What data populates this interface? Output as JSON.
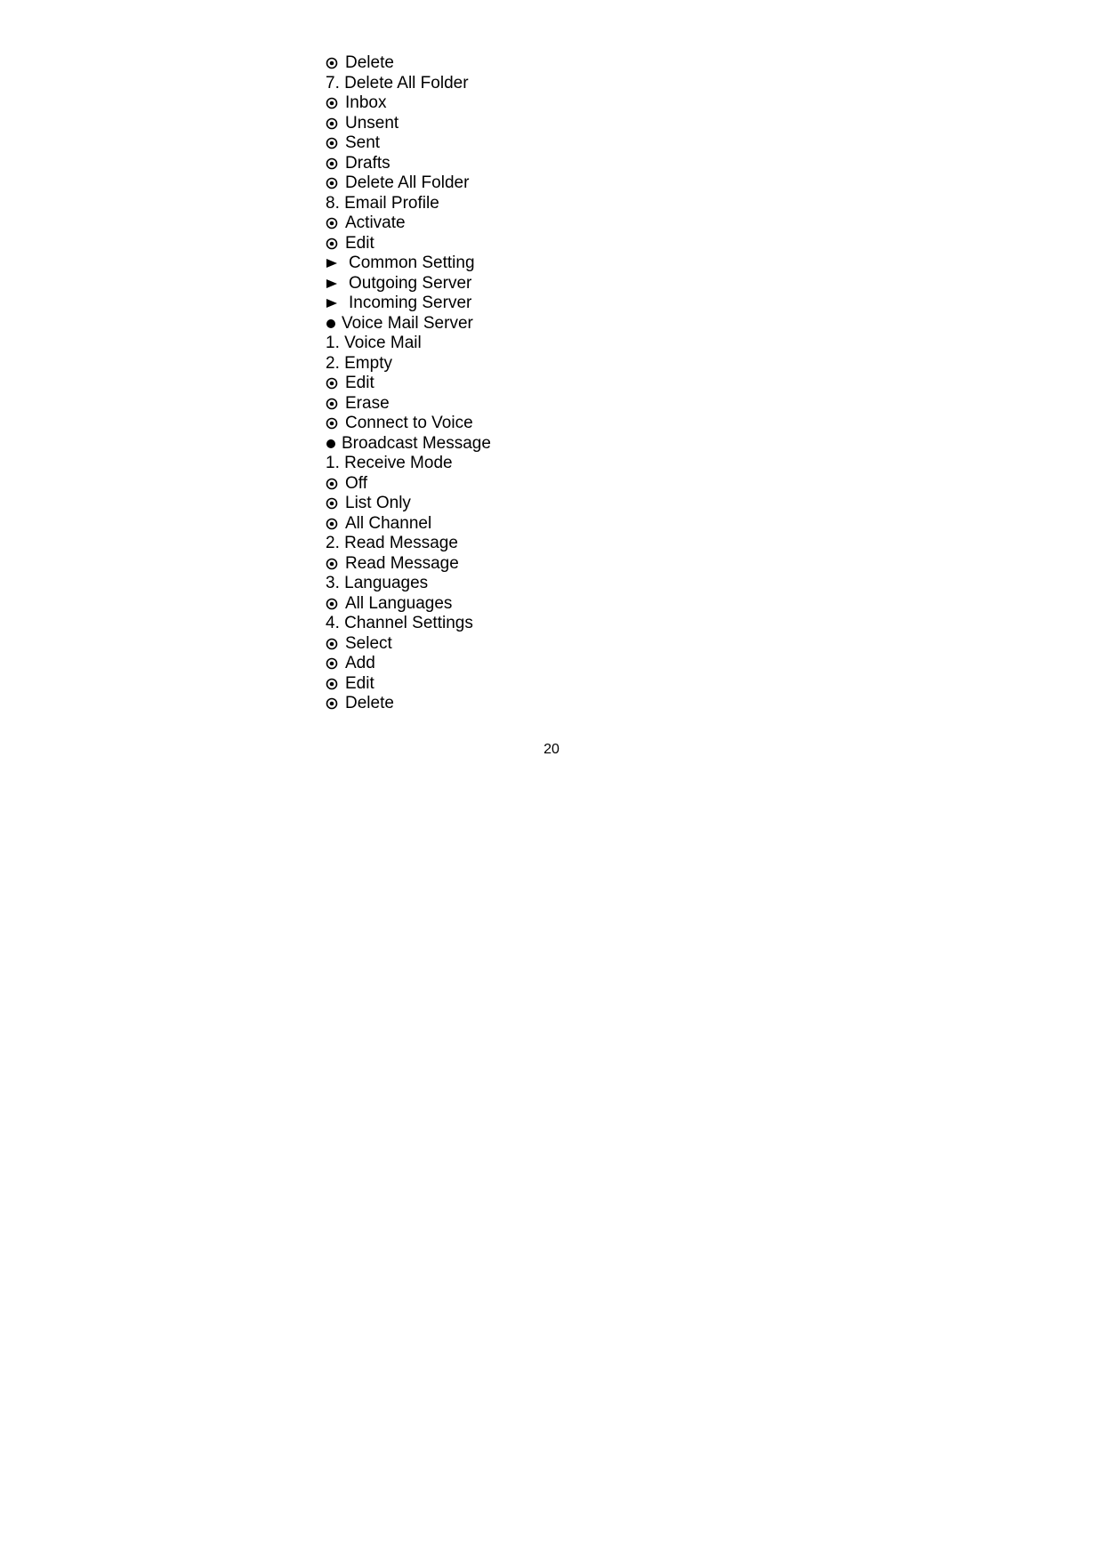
{
  "page_number": "20",
  "lines": [
    {
      "marker": "odot",
      "gap": 4,
      "text": "Delete"
    },
    {
      "marker": "none",
      "gap": 0,
      "text": "7. Delete All Folder"
    },
    {
      "marker": "odot",
      "gap": 4,
      "text": "Inbox"
    },
    {
      "marker": "odot",
      "gap": 4,
      "text": "Unsent"
    },
    {
      "marker": "odot",
      "gap": 4,
      "text": "Sent"
    },
    {
      "marker": "odot",
      "gap": 4,
      "text": "Drafts"
    },
    {
      "marker": "odot",
      "gap": 4,
      "text": "Delete All Folder"
    },
    {
      "marker": "none",
      "gap": 0,
      "text": "8. Email Profile"
    },
    {
      "marker": "odot",
      "gap": 4,
      "text": "Activate"
    },
    {
      "marker": "odot",
      "gap": 4,
      "text": "Edit"
    },
    {
      "marker": "tri",
      "gap": 8,
      "text": "Common Setting"
    },
    {
      "marker": "tri",
      "gap": 8,
      "text": "Outgoing Server"
    },
    {
      "marker": "tri",
      "gap": 8,
      "text": "Incoming Server"
    },
    {
      "marker": "disc",
      "gap": 0,
      "text": "Voice Mail Server"
    },
    {
      "marker": "none",
      "gap": 0,
      "text": "1. Voice Mail"
    },
    {
      "marker": "none",
      "gap": 0,
      "text": "2. Empty"
    },
    {
      "marker": "odot",
      "gap": 4,
      "text": "Edit"
    },
    {
      "marker": "odot",
      "gap": 4,
      "text": "Erase"
    },
    {
      "marker": "odot",
      "gap": 4,
      "text": "Connect to Voice"
    },
    {
      "marker": "disc",
      "gap": 0,
      "text": "Broadcast Message"
    },
    {
      "marker": "none",
      "gap": 0,
      "text": "1. Receive Mode"
    },
    {
      "marker": "odot",
      "gap": 4,
      "text": "Off"
    },
    {
      "marker": "odot",
      "gap": 4,
      "text": "List Only"
    },
    {
      "marker": "odot",
      "gap": 4,
      "text": "All Channel"
    },
    {
      "marker": "none",
      "gap": 0,
      "text": "2. Read Message"
    },
    {
      "marker": "odot",
      "gap": 4,
      "text": "Read Message"
    },
    {
      "marker": "none",
      "gap": 0,
      "text": "3. Languages"
    },
    {
      "marker": "odot",
      "gap": 4,
      "text": "All Languages"
    },
    {
      "marker": "none",
      "gap": 0,
      "text": "4. Channel Settings"
    },
    {
      "marker": "odot",
      "gap": 4,
      "text": "Select"
    },
    {
      "marker": "odot",
      "gap": 4,
      "text": "Add"
    },
    {
      "marker": "odot",
      "gap": 4,
      "text": "Edit"
    },
    {
      "marker": "odot",
      "gap": 4,
      "text": "Delete"
    }
  ]
}
